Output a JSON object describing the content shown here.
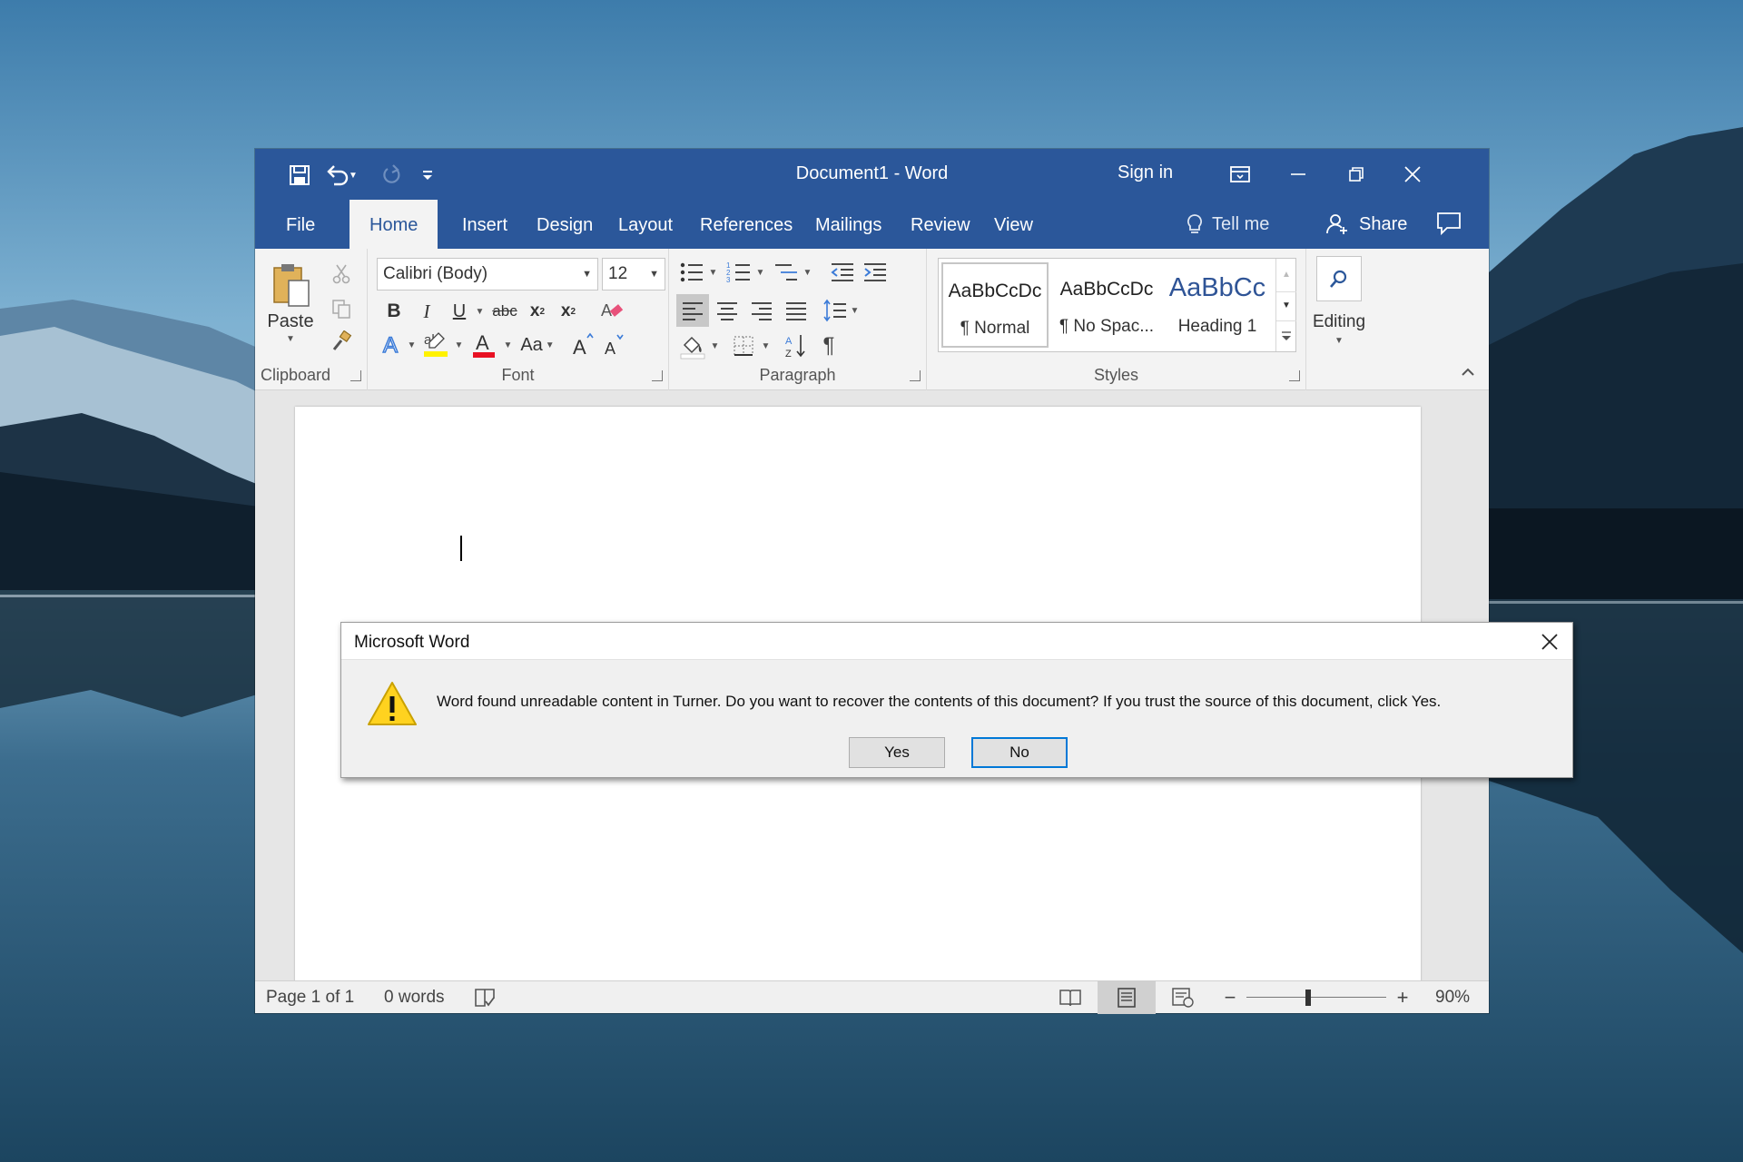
{
  "window": {
    "title": "Document1  -  Word",
    "sign_in": "Sign in"
  },
  "tabs": [
    {
      "label": "File"
    },
    {
      "label": "Home"
    },
    {
      "label": "Insert"
    },
    {
      "label": "Design"
    },
    {
      "label": "Layout"
    },
    {
      "label": "References"
    },
    {
      "label": "Mailings"
    },
    {
      "label": "Review"
    },
    {
      "label": "View"
    }
  ],
  "active_tab": "Home",
  "tell_me": "Tell me",
  "share": "Share",
  "ribbon": {
    "clipboard": {
      "paste_label": "Paste",
      "group_label": "Clipboard"
    },
    "font": {
      "font_name": "Calibri (Body)",
      "font_size": "12",
      "group_label": "Font",
      "change_case": "Aa"
    },
    "paragraph": {
      "group_label": "Paragraph"
    },
    "styles": {
      "group_label": "Styles",
      "items": [
        {
          "preview": "AaBbCcDc",
          "name": "¶ Normal"
        },
        {
          "preview": "AaBbCcDc",
          "name": "¶ No Spac..."
        },
        {
          "preview": "AaBbCc",
          "name": "Heading 1"
        }
      ]
    },
    "editing": {
      "label": "Editing"
    }
  },
  "status_bar": {
    "page": "Page 1 of 1",
    "words": "0 words",
    "zoom": "90%",
    "zoom_level_percent": 90
  },
  "dialog": {
    "title": "Microsoft Word",
    "message": "Word found unreadable content in Turner. Do you want to recover the contents of this document? If you trust the source of this document, click Yes.",
    "yes_label": "Yes",
    "no_label": "No"
  },
  "colors": {
    "word_blue": "#2b579a",
    "dialog_default_border": "#0078d7",
    "warning_yellow": "#ffd21f"
  }
}
